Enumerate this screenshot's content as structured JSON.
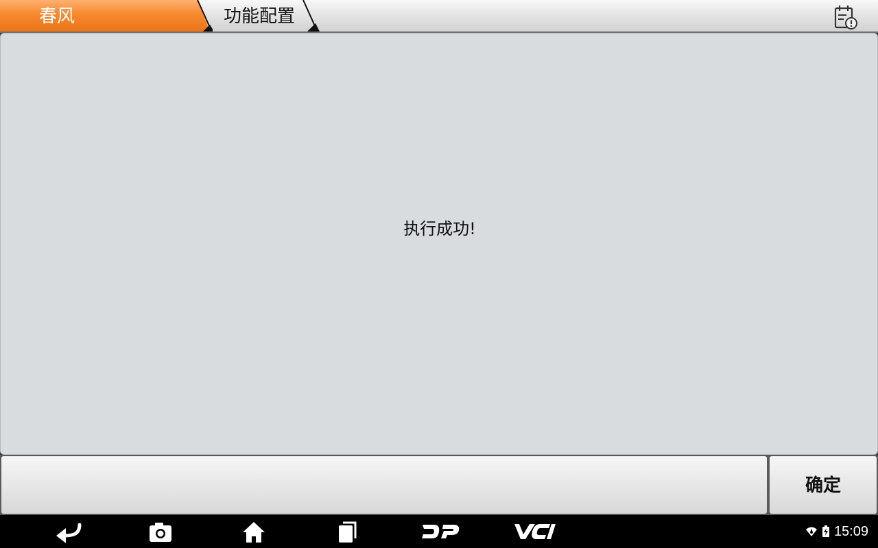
{
  "breadcrumb": {
    "items": [
      {
        "label": "春风",
        "active": true
      },
      {
        "label": "功能配置",
        "active": false
      }
    ],
    "accent_color": "#f07a25"
  },
  "main": {
    "message": "执行成功!"
  },
  "actions": {
    "ok_label": "确定"
  },
  "navbar": {
    "buttons": [
      "back-icon",
      "screenshot-icon",
      "home-icon",
      "recent-apps-icon",
      "dp-icon",
      "vci-icon"
    ],
    "status": {
      "time": "15:09",
      "icons": [
        "wifi-icon",
        "battery-icon"
      ]
    }
  }
}
